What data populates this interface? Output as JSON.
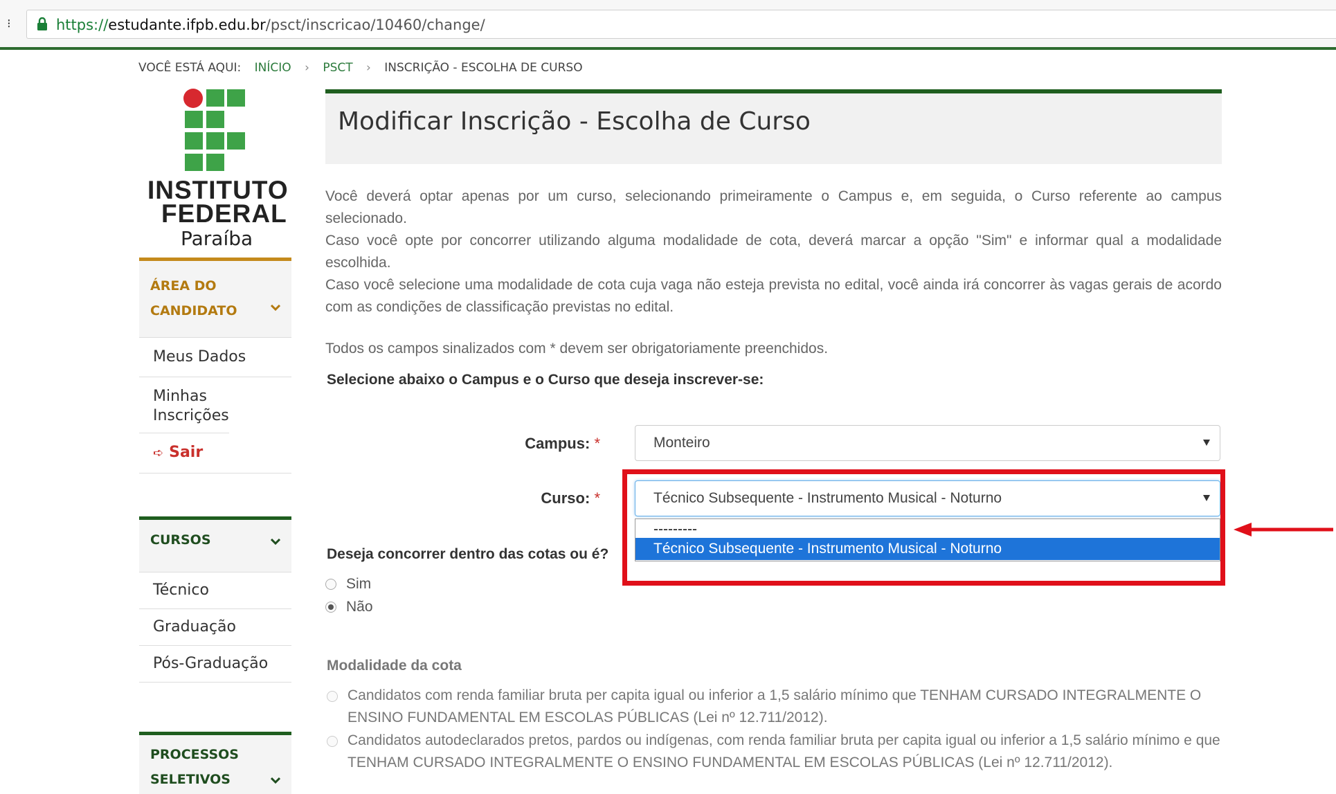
{
  "browser": {
    "url_scheme": "https://",
    "url_host": "estudante.ifpb.edu.br",
    "url_path": "/psct/inscricao/10460/change/"
  },
  "breadcrumb": {
    "prefix": "VOCÊ ESTÁ AQUI:",
    "items": [
      "INÍCIO",
      "PSCT",
      "INSCRIÇÃO - ESCOLHA DE CURSO"
    ],
    "separator": "›"
  },
  "logo": {
    "line1": "INSTITUTO",
    "line2": "FEDERAL",
    "line3": "Paraíba"
  },
  "sidebar": {
    "area_title_1": "ÁREA DO",
    "area_title_2": "CANDIDATO",
    "area_items": [
      "Meus Dados",
      "Minhas Inscrições",
      "Sair"
    ],
    "cursos_title": "CURSOS",
    "cursos_items": [
      "Técnico",
      "Graduação",
      "Pós-Graduação"
    ],
    "processos_title_1": "PROCESSOS",
    "processos_title_2": "SELETIVOS"
  },
  "main": {
    "title": "Modificar Inscrição - Escolha de Curso",
    "intro1": "Você deverá optar apenas por um curso, selecionando primeiramente o Campus e, em seguida, o Curso referente ao campus selecionado.",
    "intro2": "Caso você opte por concorrer utilizando alguma modalidade de cota, deverá marcar a opção \"Sim\" e informar qual a modalidade escolhida.",
    "intro3": "Caso você selecione uma modalidade de cota cuja vaga não esteja prevista no edital, você ainda irá concorrer às vagas gerais de acordo com as condições de classificação previstas no edital.",
    "required_note": "Todos os campos sinalizados com * devem ser obrigatoriamente preenchidos.",
    "select_heading": "Selecione abaixo o Campus e o Curso que deseja inscrever-se:",
    "campus_label": "Campus:",
    "campus_value": "Monteiro",
    "curso_label": "Curso:",
    "curso_value": "Técnico Subsequente - Instrumento Musical - Noturno",
    "required_mark": "*",
    "dropdown_options": [
      "---------",
      "Técnico Subsequente - Instrumento Musical - Noturno"
    ],
    "cota_question": "Deseja concorrer dentro das cotas ou é",
    "cota_question_tail": "?",
    "radio_sim": "Sim",
    "radio_nao": "Não",
    "modalidade_heading": "Modalidade da cota",
    "cota_options": [
      "Candidatos com renda familiar bruta per capita igual ou inferior a 1,5 salário mínimo que TENHAM CURSADO INTEGRALMENTE O ENSINO FUNDAMENTAL EM ESCOLAS PÚBLICAS (Lei nº 12.711/2012).",
      "Candidatos autodeclarados pretos, pardos ou indígenas, com renda familiar bruta per capita igual ou inferior a 1,5 salário mínimo e que TENHAM CURSADO INTEGRALMENTE O ENSINO FUNDAMENTAL EM ESCOLAS PÚBLICAS (Lei nº 12.711/2012)."
    ]
  },
  "colors": {
    "green_dark": "#1f5e1f",
    "green_logo": "#3ea348",
    "red_logo": "#d7282f",
    "gold": "#c48a1c",
    "highlight_red": "#e0101a",
    "option_selected": "#1e74d9"
  }
}
